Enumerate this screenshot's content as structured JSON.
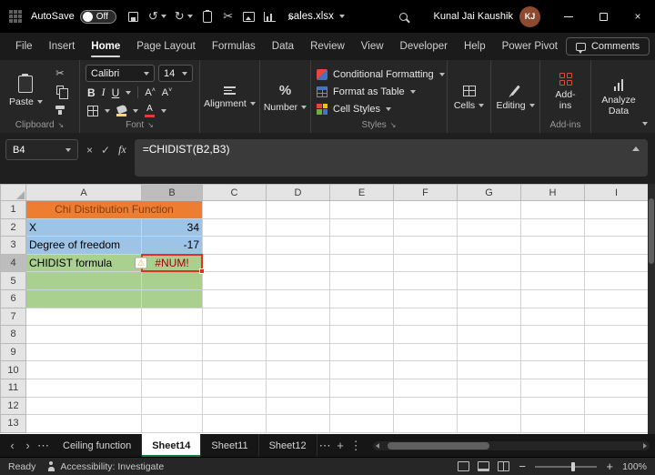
{
  "titlebar": {
    "autosave_label": "AutoSave",
    "autosave_state": "Off",
    "filename": "sales.xlsx",
    "user_name": "Kunal Jai Kaushik",
    "user_initials": "KJ"
  },
  "menubar": {
    "tabs": [
      "File",
      "Insert",
      "Home",
      "Page Layout",
      "Formulas",
      "Data",
      "Review",
      "View",
      "Developer",
      "Help",
      "Power Pivot"
    ],
    "active_tab": "Home",
    "comments_label": "Comments"
  },
  "ribbon": {
    "paste_label": "Paste",
    "clipboard_group": "Clipboard",
    "font_name": "Calibri",
    "font_size": "14",
    "bold_label": "B",
    "italic_label": "I",
    "underline_label": "U",
    "font_group": "Font",
    "alignment_label": "Alignment",
    "percent_glyph": "%",
    "number_label": "Number",
    "conditional_formatting_label": "Conditional Formatting",
    "format_as_table_label": "Format as Table",
    "cell_styles_label": "Cell Styles",
    "styles_group": "Styles",
    "cells_label": "Cells",
    "editing_label": "Editing",
    "addins_label": "Add-ins",
    "addins_group": "Add-ins",
    "analyze_data_label": "Analyze Data"
  },
  "formula_bar": {
    "name_box": "B4",
    "cancel_glyph": "×",
    "enter_glyph": "✓",
    "fx_label": "fx",
    "formula": "=CHIDIST(B2,B3)"
  },
  "grid": {
    "columns": [
      "A",
      "B",
      "C",
      "D",
      "E",
      "F",
      "G",
      "H",
      "I"
    ],
    "row_count": 13,
    "selected_cell": "B4",
    "selected_column": "B",
    "selected_row": 4,
    "cells": [
      {
        "ref": "A1",
        "row": 1,
        "col": "A",
        "colspan": 2,
        "text": "Chi Distribution Function",
        "fill": "orange",
        "text_color": "title",
        "align": "center"
      },
      {
        "ref": "A2",
        "row": 2,
        "col": "A",
        "text": "X",
        "fill": "blue"
      },
      {
        "ref": "B2",
        "row": 2,
        "col": "B",
        "text": "34",
        "fill": "blue",
        "align": "right"
      },
      {
        "ref": "A3",
        "row": 3,
        "col": "A",
        "text": "Degree of freedom",
        "fill": "blue"
      },
      {
        "ref": "B3",
        "row": 3,
        "col": "B",
        "text": "-17",
        "fill": "blue",
        "align": "right"
      },
      {
        "ref": "A4",
        "row": 4,
        "col": "A",
        "text": "CHIDIST formula",
        "fill": "green",
        "warning": true
      },
      {
        "ref": "B4",
        "row": 4,
        "col": "B",
        "text": "#NUM!",
        "fill": "green",
        "text_color": "error",
        "align": "center"
      },
      {
        "ref": "A5",
        "row": 5,
        "col": "A",
        "text": "",
        "fill": "green"
      },
      {
        "ref": "B5",
        "row": 5,
        "col": "B",
        "text": "",
        "fill": "green"
      },
      {
        "ref": "A6",
        "row": 6,
        "col": "A",
        "text": "",
        "fill": "green"
      },
      {
        "ref": "B6",
        "row": 6,
        "col": "B",
        "text": "",
        "fill": "green"
      }
    ]
  },
  "sheet_tabs": {
    "tabs": [
      {
        "name": "Ceiling function",
        "active": false
      },
      {
        "name": "Sheet14",
        "active": true
      },
      {
        "name": "Sheet11",
        "active": false
      },
      {
        "name": "Sheet12",
        "active": false
      }
    ]
  },
  "status_bar": {
    "ready_label": "Ready",
    "accessibility_label": "Accessibility: Investigate",
    "zoom_level": "100%"
  },
  "colors": {
    "accent_green": "#107C41",
    "selection_border": "#E0301E",
    "fill_orange": "#ED7D31",
    "fill_blue": "#9DC3E6",
    "fill_green": "#A9D08E",
    "title_text": "#843C0C",
    "error_text": "#9C0006",
    "avatar_bg": "#8E4A2F"
  }
}
